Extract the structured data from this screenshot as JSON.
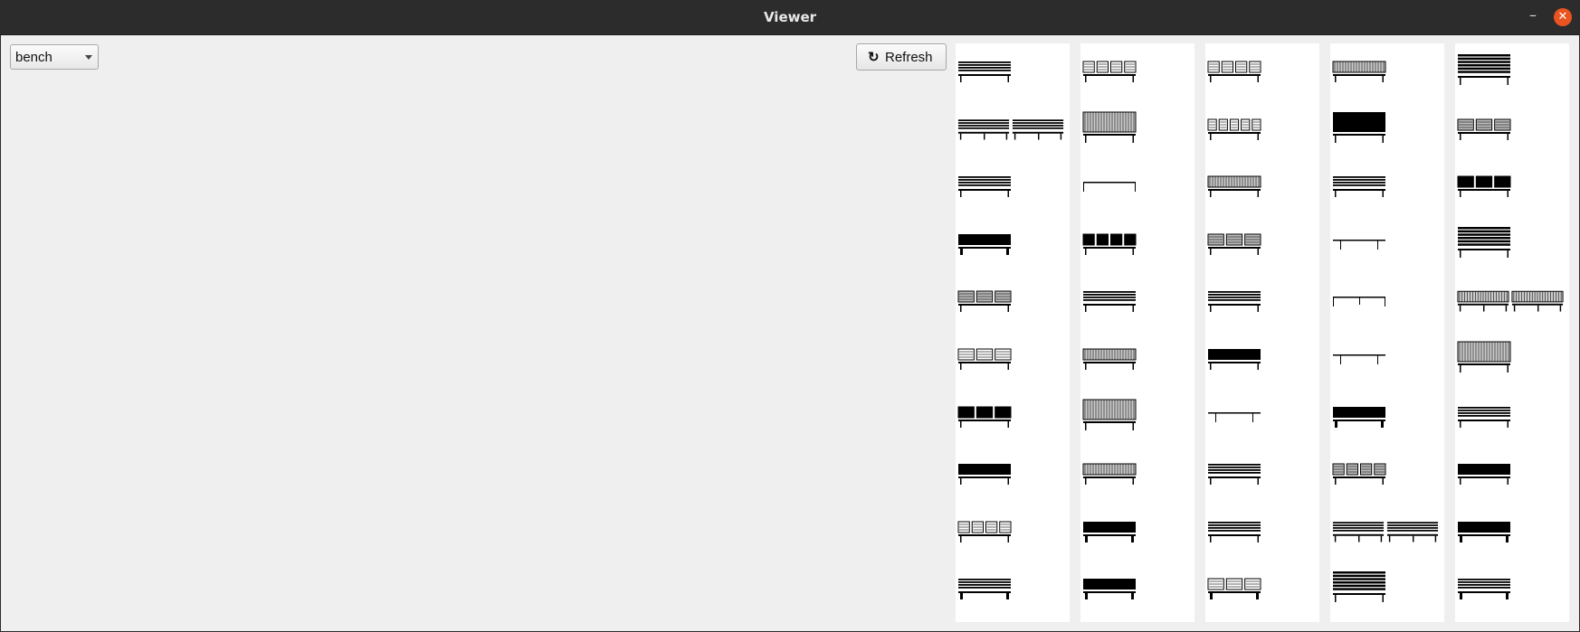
{
  "window": {
    "title": "Viewer",
    "minimize_glyph": "–",
    "close_glyph": "✕"
  },
  "toolbar": {
    "category_select": {
      "selected": "bench"
    },
    "refresh_label": "Refresh",
    "refresh_icon": "↻"
  },
  "gallery": {
    "columns": [
      [
        "bench-slats-4",
        "bench-pair-slats",
        "bench-slats-5",
        "bench-solid-legs",
        "bench-3-seat-ribbed",
        "bench-3-seat-backed",
        "bench-3-seat-dark",
        "bench-long-dark",
        "bench-4-seat-small",
        "bench-slats-3-legs"
      ],
      [
        "bench-4-seat-backed",
        "bench-ribbed-tall",
        "bench-table-plain",
        "bench-4-seat-dark",
        "bench-slats-wide",
        "bench-ribbed-low",
        "bench-double-grid",
        "bench-ribbed-rail",
        "bench-heavy-thick",
        "bench-slats-dark-legs"
      ],
      [
        "bench-4-seat-rail",
        "bench-5-seat-mini",
        "bench-ribbed-rail",
        "bench-3-seat-grid",
        "bench-slats-lined",
        "bench-solid-dark",
        "bench-slats-table",
        "bench-rounded-slats",
        "bench-wide-slats-backed",
        "bench-3-seat-legs"
      ],
      [
        "bench-ribbed-thin",
        "bench-tall-dark",
        "bench-picnic",
        "bench-plain-line",
        "bench-plain-post",
        "bench-plain-frame",
        "bench-heavy-legs",
        "bench-4-seat-grey",
        "bench-pair-light",
        "bench-double-tall"
      ],
      [
        "bench-double-chair",
        "bench-3-seat-grid",
        "bench-3-seat-box",
        "bench-tall-chair",
        "bench-pair-grey",
        "bench-double-grid",
        "bench-slats-mid",
        "bench-dark-box",
        "bench-heavy-slats",
        "bench-slats-backed-legs"
      ]
    ]
  }
}
